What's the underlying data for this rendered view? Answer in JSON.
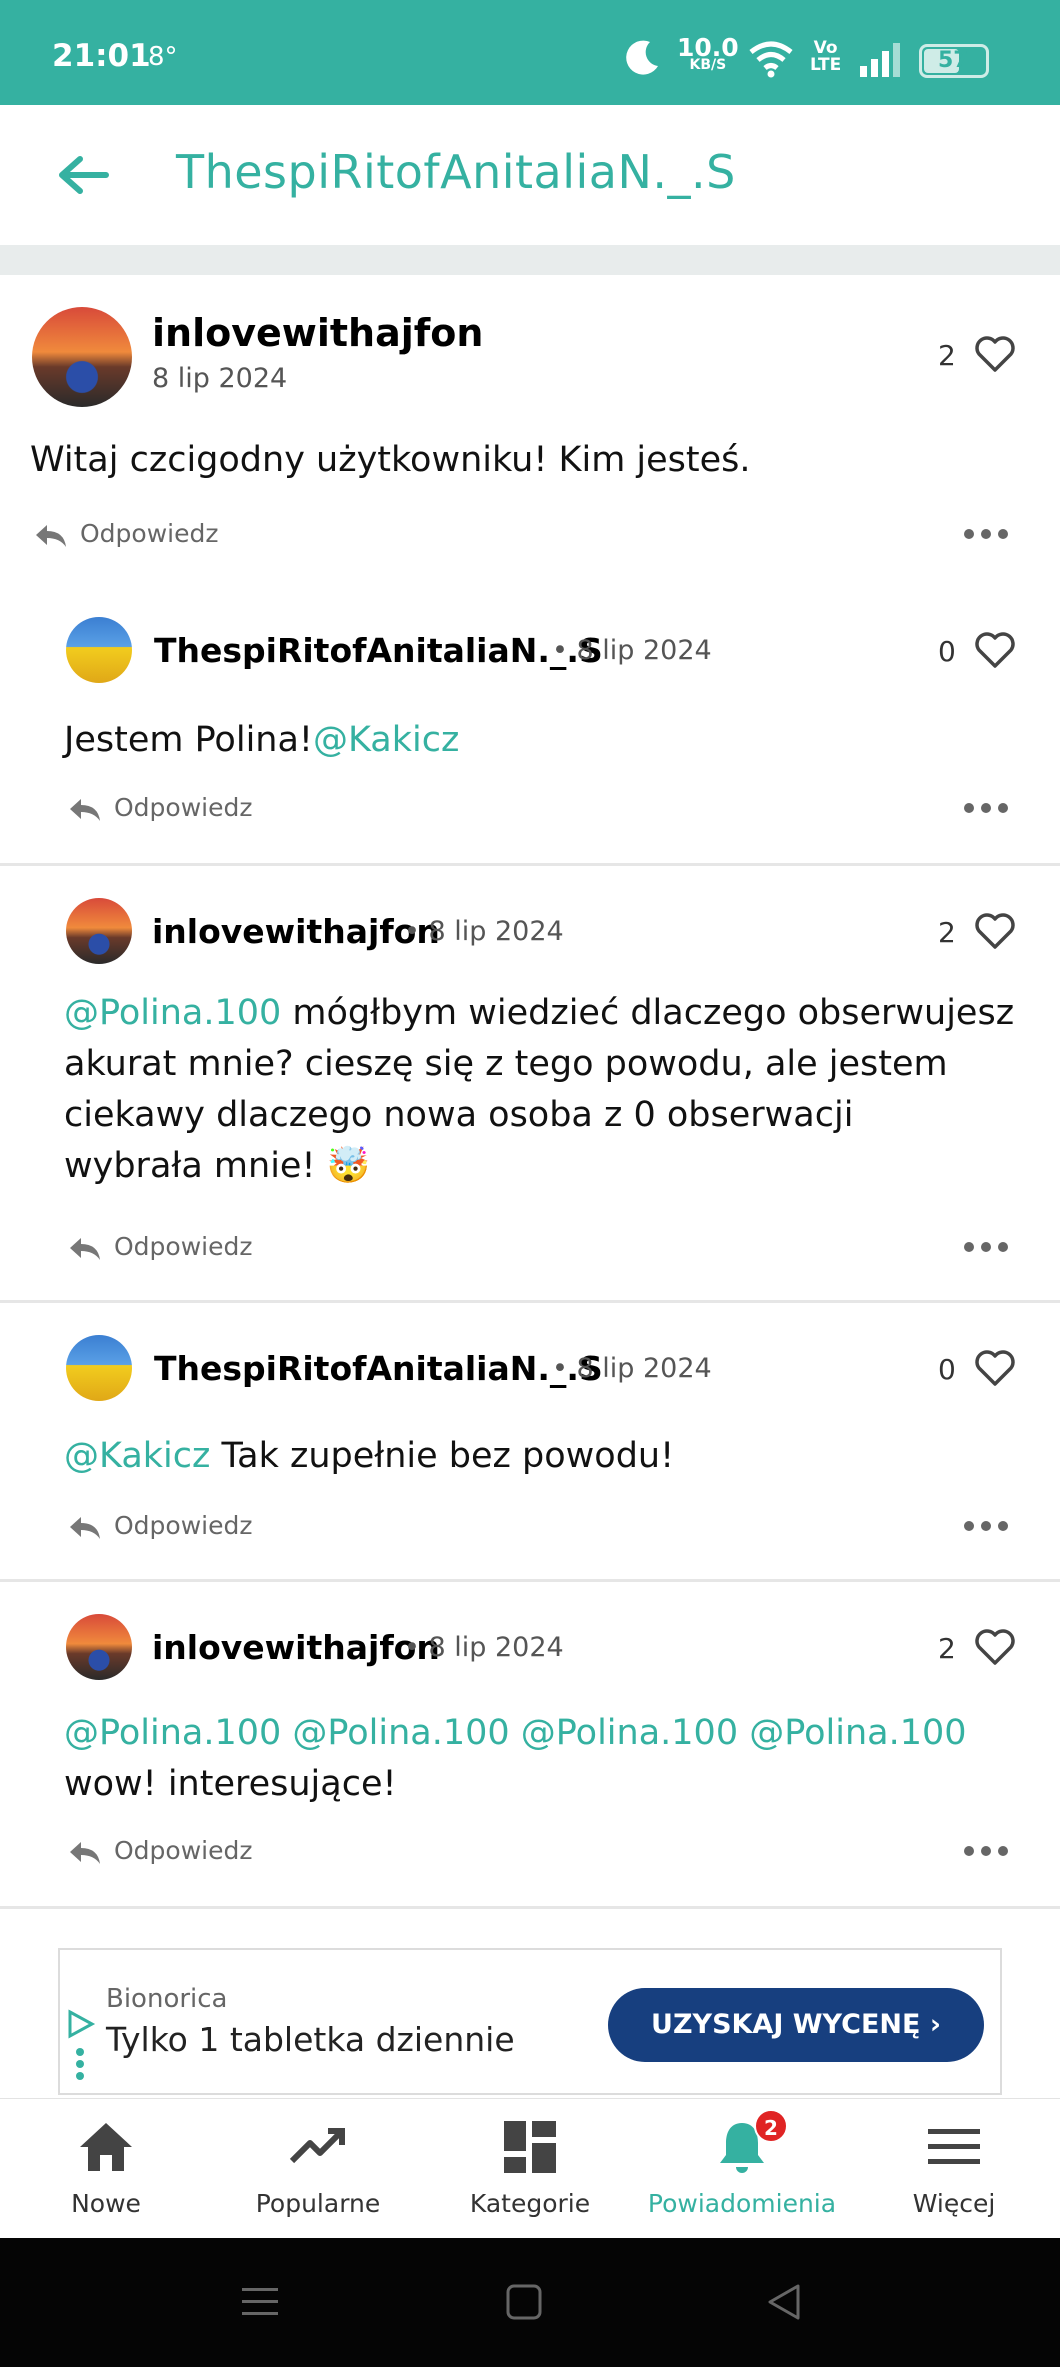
{
  "status_bar": {
    "time": "21:01",
    "temperature": "8°",
    "network_speed": "10.0",
    "network_unit": "KB/S",
    "volte": "Vo",
    "lte": "LTE",
    "battery": "57"
  },
  "header": {
    "title": "ThespiRitofAnitaliaN._.S"
  },
  "comments": [
    {
      "author": "inlovewithajfon",
      "date": "8 lip 2024",
      "likes": "2",
      "text_plain": "Witaj czcigodny użytkowniku! Kim jesteś.",
      "reply_label": "Odpowiedz"
    },
    {
      "author": "ThespiRitofAnitaliaN._.S",
      "date": "8 lip 2024",
      "likes": "0",
      "text_plain": "Jestem Polina!",
      "mention": "@Kakicz",
      "reply_label": "Odpowiedz"
    },
    {
      "author": "inlovewithajfon",
      "date": "8 lip 2024",
      "likes": "2",
      "mention": "@Polina.100",
      "text_line1": " mógłbym wiedzieć dlaczego obserwujesz",
      "text_line2": "akurat mnie? cieszę się z tego powodu, ale jestem",
      "text_line3": "ciekawy dlaczego nowa osoba z 0 obserwacji",
      "text_line4": "wybrała mnie! 🤯",
      "reply_label": "Odpowiedz"
    },
    {
      "author": "ThespiRitofAnitaliaN._.S",
      "date": "8 lip 2024",
      "likes": "0",
      "mention": "@Kakicz",
      "text_plain": " Tak zupełnie bez powodu!",
      "reply_label": "Odpowiedz"
    },
    {
      "author": "inlovewithajfon",
      "date": "8 lip 2024",
      "likes": "2",
      "mentions": "@Polina.100 @Polina.100 @Polina.100 @Polina.100",
      "text_plain": "wow! interesujące!",
      "reply_label": "Odpowiedz"
    }
  ],
  "ad": {
    "brand": "Bionorica",
    "tagline": "Tylko 1 tabletka dziennie",
    "cta": "UZYSKAJ WYCENĘ ›"
  },
  "nav": {
    "items": [
      {
        "label": "Nowe",
        "icon": "home-icon"
      },
      {
        "label": "Popularne",
        "icon": "trending-icon"
      },
      {
        "label": "Kategorie",
        "icon": "grid-icon"
      },
      {
        "label": "Powiadomienia",
        "icon": "bell-icon",
        "badge": "2"
      },
      {
        "label": "Więcej",
        "icon": "menu-icon"
      }
    ]
  },
  "colors": {
    "accent": "#35b1a1",
    "ad_button": "#173f7f",
    "badge": "#e02424"
  }
}
